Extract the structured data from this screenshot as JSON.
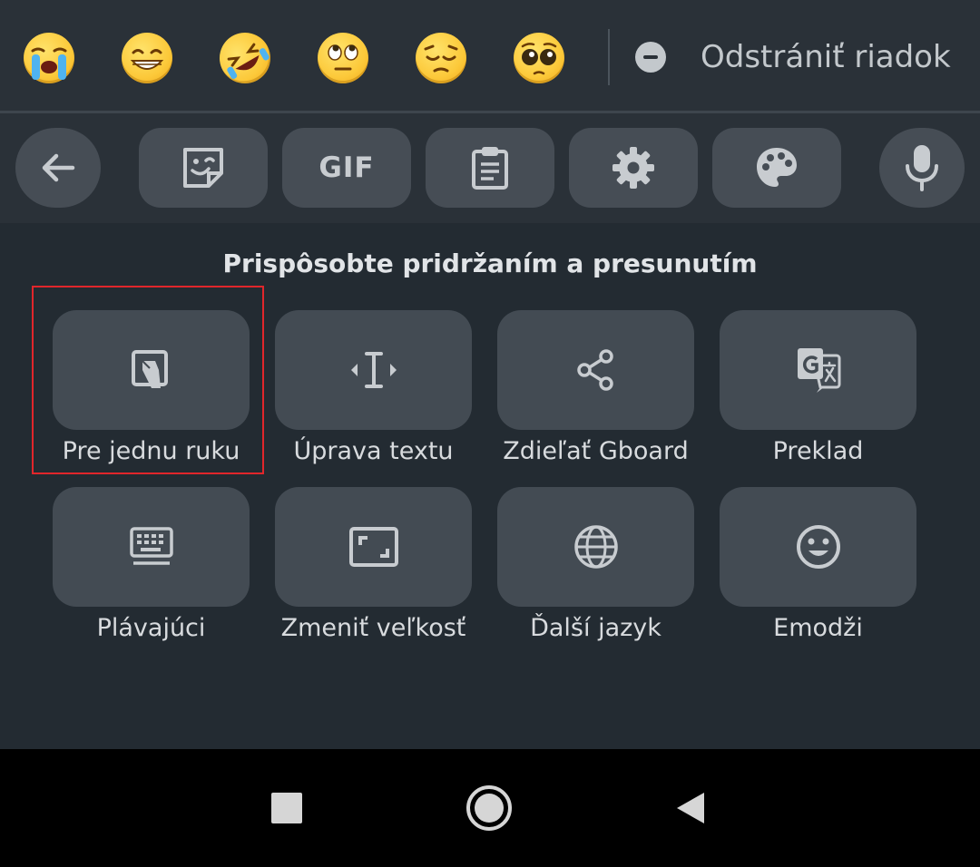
{
  "suggestions": {
    "emojis": [
      {
        "icon": "loudly-crying-face-emoji"
      },
      {
        "icon": "grinning-face-emoji"
      },
      {
        "icon": "rolling-on-floor-laughing-emoji"
      },
      {
        "icon": "face-with-rolling-eyes-emoji"
      },
      {
        "icon": "pensive-face-emoji"
      },
      {
        "icon": "pleading-face-emoji"
      }
    ],
    "remove_label": "Odstrániť riadok"
  },
  "toolbar": {
    "gif_label": "GIF",
    "items": [
      "back-arrow-icon",
      "sticker-icon",
      "gif-icon",
      "clipboard-icon",
      "gear-icon",
      "palette-icon",
      "microphone-icon"
    ]
  },
  "panel": {
    "title": "Prispôsobte pridržaním a presunutím",
    "tiles": [
      {
        "label": "Pre jednu ruku",
        "icon": "one-handed-icon"
      },
      {
        "label": "Úprava textu",
        "icon": "text-cursor-icon"
      },
      {
        "label": "Zdieľať Gboard",
        "icon": "share-icon"
      },
      {
        "label": "Preklad",
        "icon": "translate-icon"
      },
      {
        "label": "Plávajúci",
        "icon": "floating-keyboard-icon"
      },
      {
        "label": "Zmeniť veľkosť",
        "icon": "resize-icon"
      },
      {
        "label": "Ďalší jazyk",
        "icon": "globe-icon"
      },
      {
        "label": "Emodži",
        "icon": "smiley-icon"
      }
    ]
  },
  "colors": {
    "background": "#232b32",
    "bar": "#2a3138",
    "button": "#464d55",
    "icon": "#c8ccd0",
    "highlight": "#e1262b"
  }
}
